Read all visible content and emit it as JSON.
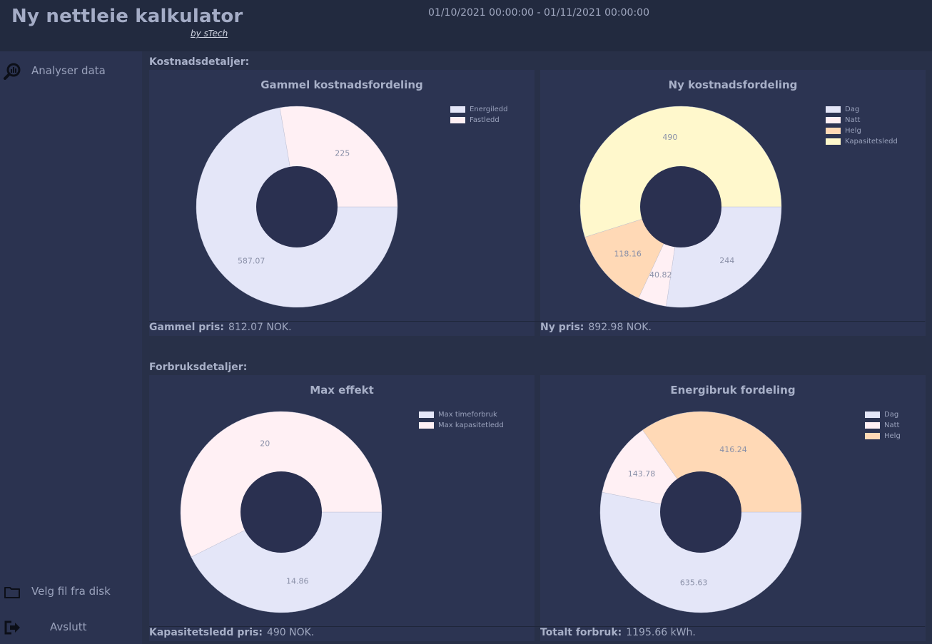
{
  "header": {
    "title": "Ny nettleie kalkulator",
    "byline": "by sTech",
    "date_range": "01/10/2021 00:00:00 - 01/11/2021 00:00:00"
  },
  "sidebar": {
    "items": [
      {
        "label": "Analyser data",
        "icon": "analytics-magnifier-icon"
      },
      {
        "label": "Velg fil fra disk",
        "icon": "folder-icon"
      },
      {
        "label": "Avslutt",
        "icon": "exit-icon"
      }
    ]
  },
  "sections": {
    "cost": "Kostnadsdetaljer:",
    "usage": "Forbruksdetaljer:"
  },
  "summaries": {
    "old_price": {
      "label": "Gammel pris:",
      "value": "812.07 NOK."
    },
    "new_price": {
      "label": "Ny pris:",
      "value": "892.98 NOK."
    },
    "capacity_price": {
      "label": "Kapasitetsledd pris:",
      "value": "490 NOK."
    },
    "total_usage": {
      "label": "Totalt forbruk:",
      "value": "1195.66 kWh."
    }
  },
  "colors": {
    "background": "#283048",
    "panel": "#2c3452",
    "lavender": "#e4e6f8",
    "pink": "#fff0f4",
    "peach": "#ffd9b6",
    "cream": "#fff8cc"
  },
  "chart_data": [
    {
      "type": "pie",
      "title": "Gammel kostnadsfordeling",
      "legend_position": "top-right",
      "categories": [
        "Energiledd",
        "Fastledd"
      ],
      "values": [
        587.07,
        225
      ],
      "labels": [
        "587.07",
        "225"
      ],
      "colors": [
        "#e4e6f8",
        "#fff0f4"
      ]
    },
    {
      "type": "pie",
      "title": "Ny kostnadsfordeling",
      "legend_position": "top-right",
      "categories": [
        "Dag",
        "Natt",
        "Helg",
        "Kapasitetsledd"
      ],
      "values": [
        244,
        40.82,
        118.16,
        490
      ],
      "labels": [
        "244",
        "40.82",
        "118.16",
        "490"
      ],
      "colors": [
        "#e4e6f8",
        "#fff0f4",
        "#ffd9b6",
        "#fff8cc"
      ]
    },
    {
      "type": "pie",
      "title": "Max effekt",
      "legend_position": "top-right",
      "categories": [
        "Max timeforbruk",
        "Max kapasitetledd"
      ],
      "values": [
        14.86,
        20
      ],
      "labels": [
        "14.86",
        "20"
      ],
      "colors": [
        "#e4e6f8",
        "#fff0f4"
      ]
    },
    {
      "type": "pie",
      "title": "Energibruk fordeling",
      "legend_position": "top-right",
      "categories": [
        "Dag",
        "Natt",
        "Helg"
      ],
      "values": [
        635.63,
        143.78,
        416.24
      ],
      "labels": [
        "635.63",
        "143.78",
        "416.24"
      ],
      "colors": [
        "#e4e6f8",
        "#fff0f4",
        "#ffd9b6"
      ]
    }
  ]
}
